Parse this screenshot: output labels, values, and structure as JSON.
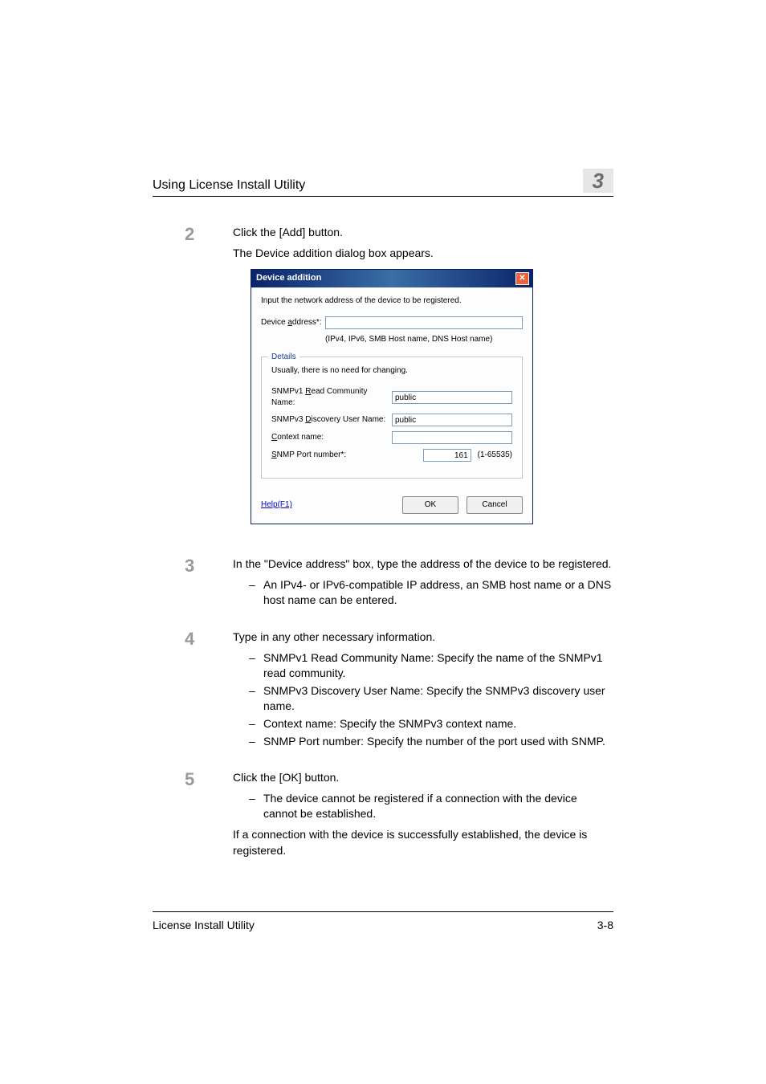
{
  "header": {
    "title": "Using License Install Utility",
    "chapter": "3"
  },
  "steps": {
    "s2": {
      "num": "2",
      "line1": "Click the [Add] button.",
      "line2": "The Device addition dialog box appears."
    },
    "s3": {
      "num": "3",
      "line1": "In the \"Device address\" box, type the address of the device to be registered.",
      "bullets": [
        "An IPv4- or IPv6-compatible IP address, an SMB host name or a DNS host name can be entered."
      ]
    },
    "s4": {
      "num": "4",
      "line1": "Type in any other necessary information.",
      "bullets": [
        "SNMPv1 Read Community Name: Specify the name of the SNMPv1 read community.",
        "SNMPv3 Discovery User Name: Specify the SNMPv3 discovery user name.",
        "Context name: Specify the SNMPv3 context name.",
        "SNMP Port number: Specify the number of the port used with SNMP."
      ]
    },
    "s5": {
      "num": "5",
      "line1": "Click the [OK] button.",
      "bullets": [
        "The device cannot be registered if a connection with the device cannot be established."
      ],
      "line2": "If a connection with the device is successfully established, the device is registered."
    }
  },
  "dialog": {
    "title": "Device addition",
    "intro": "Input the network address of the device to be registered.",
    "address_label_pre": "Device ",
    "address_label_u": "a",
    "address_label_post": "ddress*:",
    "address_value": "",
    "hint": "(IPv4, IPv6, SMB Host name, DNS Host name)",
    "details_legend": "Details",
    "details_note": "Usually, there is no need for changing.",
    "read_label_pre": "SNMPv1 ",
    "read_label_u": "R",
    "read_label_post": "ead Community Name:",
    "read_value": "public",
    "disc_label_pre": "SNMPv3 ",
    "disc_label_u": "D",
    "disc_label_post": "iscovery User Name:",
    "disc_value": "public",
    "ctx_label_u": "C",
    "ctx_label_post": "ontext name:",
    "ctx_value": "",
    "port_label_u": "S",
    "port_label_post": "NMP Port number*:",
    "port_value": "161",
    "port_range": "(1-65535)",
    "help": "Help(F1)",
    "ok": "OK",
    "cancel": "Cancel"
  },
  "footer": {
    "left": "License Install Utility",
    "right": "3-8"
  }
}
